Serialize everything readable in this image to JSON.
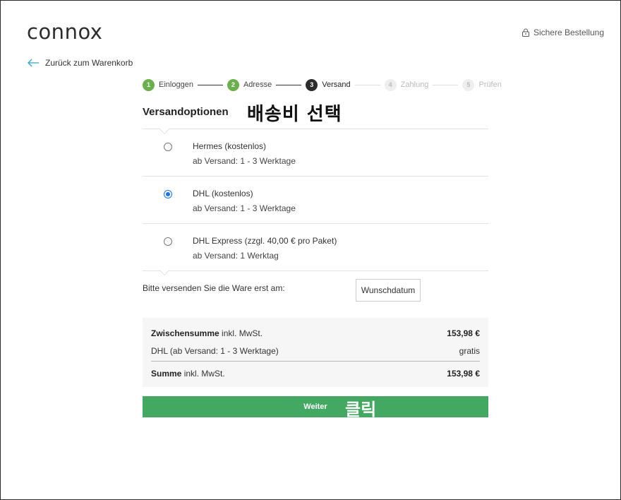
{
  "brand": {
    "logo": "connox"
  },
  "header": {
    "secure_label": "Sichere Bestellung"
  },
  "nav": {
    "back_label": "Zurück zum Warenkorb"
  },
  "steps": [
    {
      "num": "1",
      "label": "Einloggen",
      "state": "done"
    },
    {
      "num": "2",
      "label": "Adresse",
      "state": "done"
    },
    {
      "num": "3",
      "label": "Versand",
      "state": "active"
    },
    {
      "num": "4",
      "label": "Zahlung",
      "state": "todo"
    },
    {
      "num": "5",
      "label": "Prüfen",
      "state": "todo"
    }
  ],
  "shipping": {
    "heading": "Versandoptionen",
    "annotation": "배송비 선택",
    "options": [
      {
        "name": "Hermes (kostenlos)",
        "detail": "ab Versand: 1 - 3 Werktage",
        "selected": false
      },
      {
        "name": "DHL (kostenlos)",
        "detail": "ab Versand: 1 - 3 Werktage",
        "selected": true
      },
      {
        "name": "DHL Express (zzgl. 40,00 € pro Paket)",
        "detail": "ab Versand: 1 Werktag",
        "selected": false
      }
    ],
    "ship_date_note": "Bitte versenden Sie die Ware erst am:",
    "wish_date_button": "Wunschdatum"
  },
  "summary": {
    "subtotal_bold": "Zwischensumme",
    "subtotal_rest": " inkl. MwSt.",
    "subtotal_value": "153,98 €",
    "shipping_label": "DHL (ab Versand: 1 - 3 Werktage)",
    "shipping_value": "gratis",
    "total_bold": "Summe",
    "total_rest": " inkl. MwSt.",
    "total_value": "153,98 €"
  },
  "cta": {
    "label": "Weiter",
    "annotation": "클릭"
  },
  "colors": {
    "accent_green": "#43a861",
    "step_done": "#6ab04c",
    "radio_selected": "#1a73e8"
  }
}
